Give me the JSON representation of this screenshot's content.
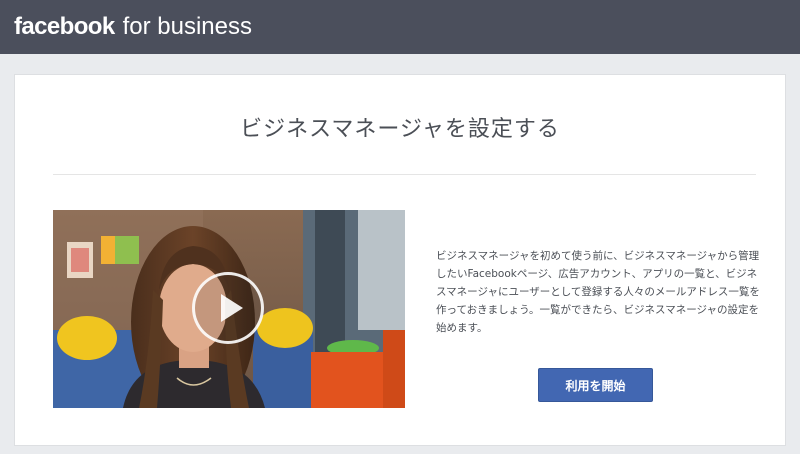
{
  "header": {
    "brand_bold": "facebook",
    "brand_light": "for business",
    "background_color": "#4b4f5c"
  },
  "main": {
    "title": "ビジネスマネージャを設定する",
    "description": "ビジネスマネージャを初めて使う前に、ビジネスマネージャから管理したいFacebookページ、広告アカウント、アプリの一覧と、ビジネスマネージャにユーザーとして登録する人々のメールアドレス一覧を作っておきましょう。一覧ができたら、ビジネスマネージャの設定を始めます。",
    "start_button_label": "利用を開始",
    "accent_color": "#4267b2"
  },
  "video": {
    "play_icon": "play-icon"
  }
}
